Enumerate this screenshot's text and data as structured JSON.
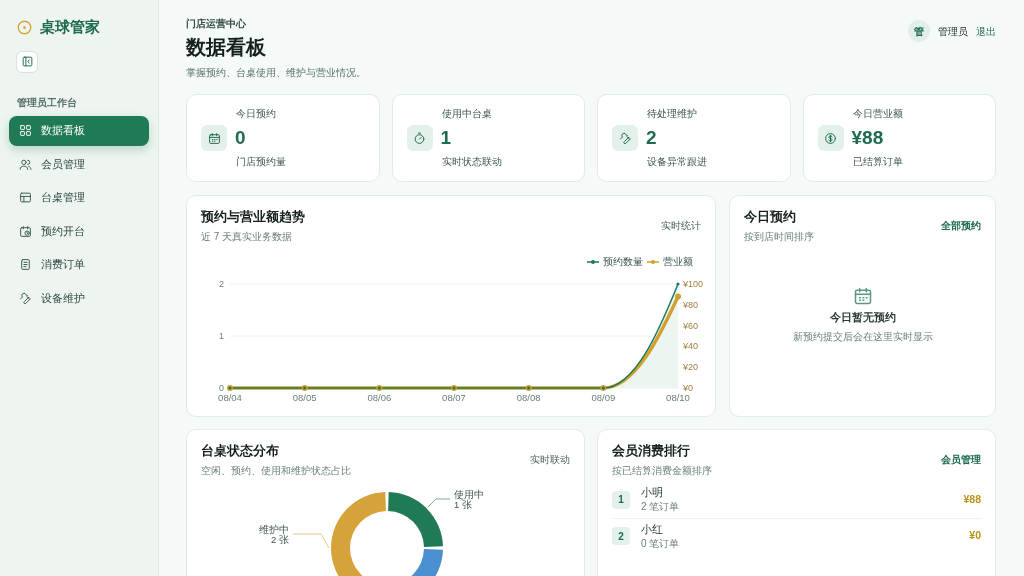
{
  "brand": {
    "name": "桌球管家"
  },
  "sidebar": {
    "section_title": "管理员工作台",
    "items": [
      {
        "label": "数据看板",
        "selected": true
      },
      {
        "label": "会员管理",
        "selected": false
      },
      {
        "label": "台桌管理",
        "selected": false
      },
      {
        "label": "预约开台",
        "selected": false
      },
      {
        "label": "消费订单",
        "selected": false
      },
      {
        "label": "设备维护",
        "selected": false
      }
    ]
  },
  "header": {
    "eyebrow": "门店运营中心",
    "title": "数据看板",
    "subtitle": "掌握预约、台桌使用、维护与营业情况。"
  },
  "user": {
    "avatar": "管",
    "name": "管理员",
    "logout": "退出"
  },
  "stats": [
    {
      "label": "今日预约",
      "value": "0",
      "note": "门店预约量"
    },
    {
      "label": "使用中台桌",
      "value": "1",
      "note": "实时状态联动"
    },
    {
      "label": "待处理维护",
      "value": "2",
      "note": "设备异常跟进"
    },
    {
      "label": "今日营业额",
      "value": "¥88",
      "note": "已结算订单"
    }
  ],
  "trend_card": {
    "title": "预约与营业额趋势",
    "subtitle": "近 7 天真实业务数据",
    "badge": "实时统计",
    "chart_data": {
      "type": "line",
      "legend": true,
      "categories": [
        "08/04",
        "08/05",
        "08/06",
        "08/07",
        "08/08",
        "08/09",
        "08/10"
      ],
      "series": [
        {
          "name": "预约数量",
          "color": "#1f7a55",
          "marker": true,
          "values": [
            0,
            0,
            0,
            0,
            0,
            0,
            2
          ]
        },
        {
          "name": "营业额",
          "color": "#d0a030",
          "marker": true,
          "axis": "y2",
          "values": [
            0,
            0,
            0,
            0,
            0,
            0,
            88
          ]
        }
      ],
      "ylim": [
        0,
        2
      ],
      "yticks": [
        0,
        1,
        2
      ],
      "y2lim": [
        0,
        100
      ],
      "y2ticks": [
        {
          "value": 0,
          "label": "¥0"
        },
        {
          "value": 20,
          "label": "¥20"
        },
        {
          "value": 40,
          "label": "¥40"
        },
        {
          "value": 60,
          "label": "¥60"
        },
        {
          "value": 80,
          "label": "¥80"
        },
        {
          "value": 100,
          "label": "¥100"
        }
      ]
    }
  },
  "today_card": {
    "title": "今日预约",
    "subtitle": "按到店时间排序",
    "link": "全部预约",
    "empty_title": "今日暂无预约",
    "empty_text": "新预约提交后会在这里实时显示"
  },
  "status_card": {
    "title": "台桌状态分布",
    "subtitle": "空闲、预约、使用和维护状态占比",
    "badge": "实时联动",
    "chart_data": {
      "type": "donut",
      "categories": [
        "使用中",
        null,
        "维护中"
      ],
      "values": [
        1,
        1,
        2
      ],
      "colors": [
        "#1f7a55",
        "#4a8fd0",
        "#d6a33a"
      ],
      "value_labels": [
        "1 张",
        null,
        "2 张"
      ]
    }
  },
  "ranking_card": {
    "title": "会员消费排行",
    "subtitle": "按已结算消费金额排序",
    "link": "会员管理",
    "members": [
      {
        "rank": "1",
        "name": "小明",
        "orders": "2 笔订单",
        "amount": "¥88"
      },
      {
        "rank": "2",
        "name": "小红",
        "orders": "0 笔订单",
        "amount": "¥0"
      }
    ]
  }
}
